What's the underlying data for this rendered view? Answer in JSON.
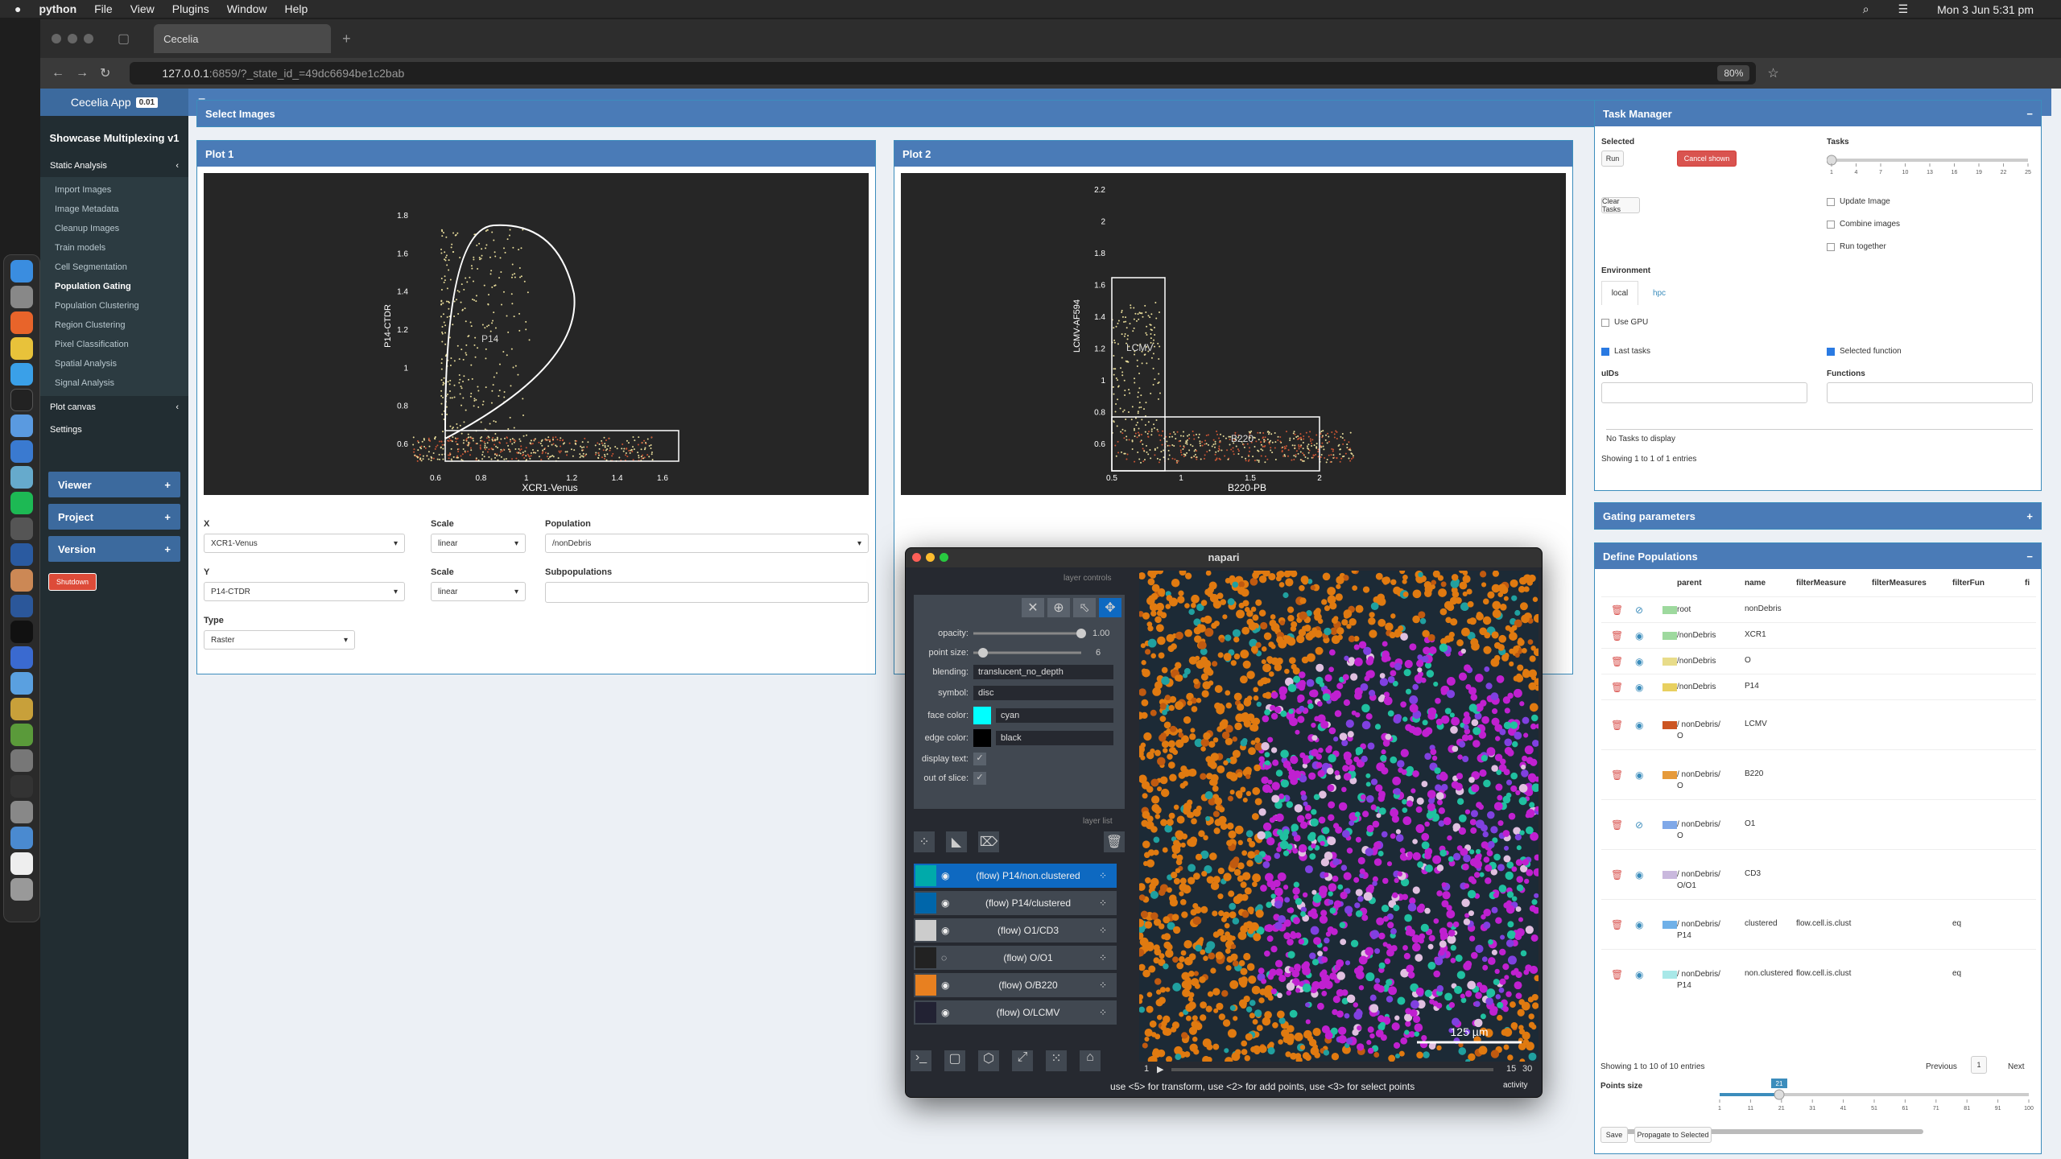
{
  "os": {
    "app": "python",
    "menus": [
      "File",
      "View",
      "Plugins",
      "Window",
      "Help"
    ],
    "clock": "Mon 3 Jun  5:31 pm"
  },
  "browser": {
    "tab_title": "Cecelia",
    "url_host": "127.0.0.1",
    "url_rest": ":6859/?_state_id_=49dc6694be1c2bab",
    "zoom": "80%"
  },
  "app": {
    "brand": "Cecelia App",
    "version": "0.01",
    "project": "Showcase Multiplexing v1"
  },
  "sidebar": {
    "static": "Static Analysis",
    "items": [
      "Import Images",
      "Image Metadata",
      "Cleanup Images",
      "Train models",
      "Cell Segmentation",
      "Population Gating",
      "Population Clustering",
      "Region Clustering",
      "Pixel Classification",
      "Spatial Analysis",
      "Signal Analysis"
    ],
    "plot_canvas": "Plot canvas",
    "settings": "Settings",
    "viewer": "Viewer",
    "project_btn": "Project",
    "version_btn": "Version",
    "shutdown": "Shutdown"
  },
  "select_images": "Select Images",
  "plot1": {
    "title": "Plot 1",
    "xlabel": "XCR1-Venus",
    "ylabel": "P14-CTDR",
    "gate": "P14",
    "xticks": [
      "0.6",
      "0.8",
      "1",
      "1.2",
      "1.4",
      "1.6"
    ],
    "yticks": [
      "0.6",
      "0.8",
      "1",
      "1.2",
      "1.4",
      "1.6",
      "1.8"
    ]
  },
  "plot2": {
    "title": "Plot 2",
    "xlabel": "B220-PB",
    "ylabel": "LCMV-AF594",
    "gate1": "LCMV",
    "gate2": "B220",
    "xticks": [
      "0.5",
      "1",
      "1.5",
      "2"
    ],
    "yticks": [
      "0.6",
      "0.8",
      "1",
      "1.2",
      "1.4",
      "1.6",
      "1.8",
      "2",
      "2.2"
    ]
  },
  "form": {
    "x_label": "X",
    "x_val": "XCR1-Venus",
    "scale_label": "Scale",
    "scale_val": "linear",
    "pop_label": "Population",
    "pop_val": "/nonDebris",
    "y_label": "Y",
    "y_val": "P14-CTDR",
    "scale2_val": "linear",
    "subpop_label": "Subpopulations",
    "type_label": "Type",
    "type_val": "Raster"
  },
  "tasks": {
    "title": "Task Manager",
    "selected": "Selected",
    "run": "Run",
    "cancel": "Cancel shown",
    "tasks_label": "Tasks",
    "clear": "Clear Tasks",
    "update": "Update Image",
    "combine": "Combine images",
    "together": "Run together",
    "env": "Environment",
    "local": "local",
    "hpc": "hpc",
    "gpu": "Use GPU",
    "last": "Last tasks",
    "selfunc": "Selected function",
    "uids": "uIDs",
    "functions": "Functions",
    "empty": "No Tasks to display",
    "entries": "Showing 1 to 1 of 1 entries",
    "slider_ticks": [
      "1",
      "4",
      "7",
      "10",
      "13",
      "16",
      "19",
      "22",
      "25"
    ],
    "slider_min": "1",
    "slider_max": "25"
  },
  "gating": {
    "title": "Gating parameters"
  },
  "define": {
    "title": "Define Populations",
    "cols": [
      "parent",
      "name",
      "filterMeasure",
      "filterMeasures",
      "filterFun",
      "fi"
    ],
    "rows": [
      {
        "parent": "root",
        "name": "nonDebris",
        "fm": "",
        "ff": "",
        "color": "#9ed99e",
        "hidden": true
      },
      {
        "parent": "/nonDebris",
        "name": "XCR1",
        "fm": "",
        "ff": "",
        "color": "#9ed99e",
        "hidden": false
      },
      {
        "parent": "/nonDebris",
        "name": "O",
        "fm": "",
        "ff": "",
        "color": "#e8dc8a",
        "hidden": false
      },
      {
        "parent": "/nonDebris",
        "name": "P14",
        "fm": "",
        "ff": "",
        "color": "#e8d060",
        "hidden": false
      },
      {
        "parent": "/ nonDebris/ O",
        "name": "LCMV",
        "fm": "",
        "ff": "",
        "color": "#cc5522",
        "hidden": false
      },
      {
        "parent": "/ nonDebris/ O",
        "name": "B220",
        "fm": "",
        "ff": "",
        "color": "#e69a3a",
        "hidden": false
      },
      {
        "parent": "/ nonDebris/ O",
        "name": "O1",
        "fm": "",
        "ff": "",
        "color": "#7fa8e8",
        "hidden": true
      },
      {
        "parent": "/ nonDebris/ O/O1",
        "name": "CD3",
        "fm": "",
        "ff": "",
        "color": "#c9b8dd",
        "hidden": false
      },
      {
        "parent": "/ nonDebris/ P14",
        "name": "clustered",
        "fm": "flow.cell.is.clust",
        "ff": "eq",
        "color": "#6fb0e8",
        "hidden": false
      },
      {
        "parent": "/ nonDebris/ P14",
        "name": "non.clustered",
        "fm": "flow.cell.is.clust",
        "ff": "eq",
        "color": "#a8e8e8",
        "hidden": false
      }
    ],
    "entries": "Showing 1 to 10 of 10 entries",
    "prev": "Previous",
    "page": "1",
    "next": "Next",
    "points": "Points size",
    "pt_ticks": [
      "1",
      "11",
      "21",
      "31",
      "41",
      "51",
      "61",
      "71",
      "81",
      "91",
      "100"
    ],
    "pt_min": "1",
    "pt_max": "100",
    "pt_val": "21",
    "save": "Save",
    "propagate": "Propagate to Selected"
  },
  "napari": {
    "title": "napari",
    "controls": "layer controls",
    "opacity_k": "opacity:",
    "opacity_v": "1.00",
    "point_k": "point size:",
    "point_v": "6",
    "blend_k": "blending:",
    "blend_v": "translucent_no_depth",
    "symbol_k": "symbol:",
    "symbol_v": "disc",
    "face_k": "face color:",
    "face_v": "cyan",
    "edge_k": "edge color:",
    "edge_v": "black",
    "disp_k": "display text:",
    "slice_k": "out of slice:",
    "layer_list": "layer list",
    "layers": [
      "(flow) P14/non.clustered",
      "(flow) P14/clustered",
      "(flow) O1/CD3",
      "(flow) O/O1",
      "(flow) O/B220",
      "(flow) O/LCMV"
    ],
    "scale": "125 µm",
    "frame": "1",
    "frame_a": "15",
    "frame_b": "30",
    "status": "use <5> for transform, use <2> for add points, use <3> for select points",
    "activity": "activity"
  }
}
